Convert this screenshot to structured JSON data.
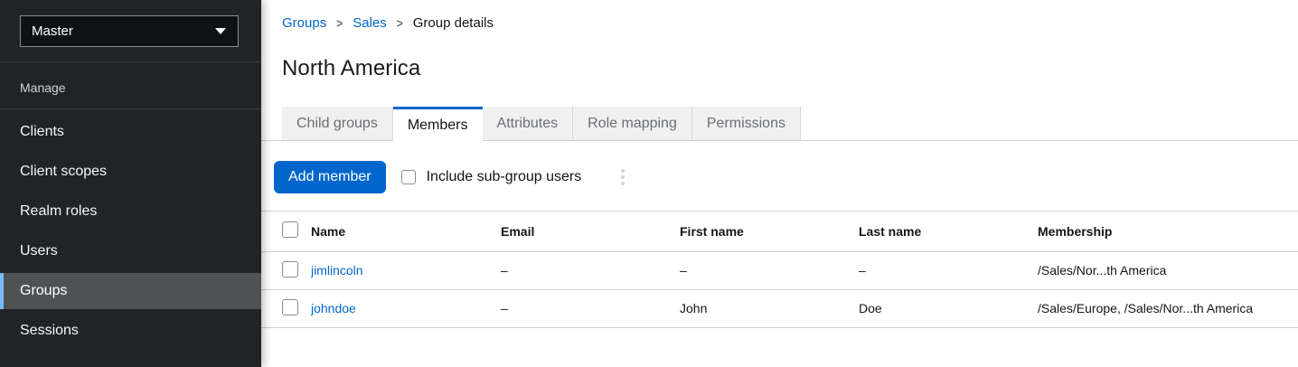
{
  "colors": {
    "accent_blue": "#0066cc",
    "nav_active_accent": "#73bcf7",
    "sidebar_bg": "#212427",
    "nav_active_bg": "#4f5255",
    "tab_inactive_bg": "#f0f0f0",
    "divider": "#d2d2d2",
    "link": "#0066cc"
  },
  "icons": {
    "realm_caret": "caret-down",
    "breadcrumb_separator": ">",
    "kebab": "kebab-vertical"
  },
  "sidebar": {
    "realm_selector": {
      "label": "Master"
    },
    "section_title": "Manage",
    "items": [
      {
        "label": "Clients",
        "active": false
      },
      {
        "label": "Client scopes",
        "active": false
      },
      {
        "label": "Realm roles",
        "active": false
      },
      {
        "label": "Users",
        "active": false
      },
      {
        "label": "Groups",
        "active": true
      },
      {
        "label": "Sessions",
        "active": false
      }
    ]
  },
  "breadcrumb": {
    "items": [
      {
        "label": "Groups",
        "link": true
      },
      {
        "label": "Sales",
        "link": true
      },
      {
        "label": "Group details",
        "link": false
      }
    ]
  },
  "page_title": "North America",
  "tabs": [
    {
      "label": "Child groups",
      "active": false
    },
    {
      "label": "Members",
      "active": true
    },
    {
      "label": "Attributes",
      "active": false
    },
    {
      "label": "Role mapping",
      "active": false
    },
    {
      "label": "Permissions",
      "active": false
    }
  ],
  "toolbar": {
    "add_member_label": "Add member",
    "include_subgroups_label": "Include sub-group users",
    "include_subgroups_checked": false
  },
  "table": {
    "columns": [
      "Name",
      "Email",
      "First name",
      "Last name",
      "Membership"
    ],
    "rows": [
      {
        "checked": false,
        "name": "jimlincoln",
        "email": "–",
        "first_name": "–",
        "last_name": "–",
        "membership": "/Sales/Nor...th America"
      },
      {
        "checked": false,
        "name": "johndoe",
        "email": "–",
        "first_name": "John",
        "last_name": "Doe",
        "membership": "/Sales/Europe, /Sales/Nor...th America"
      }
    ]
  }
}
